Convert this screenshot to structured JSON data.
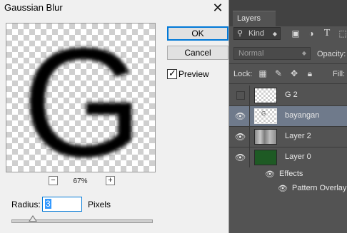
{
  "dialog": {
    "title": "Gaussian Blur",
    "close_glyph": "✕",
    "preview_letter": "G",
    "zoom_minus": "−",
    "zoom_plus": "+",
    "zoom_level": "67%",
    "ok_label": "OK",
    "cancel_label": "Cancel",
    "preview_check_glyph": "✓",
    "preview_label": "Preview",
    "preview_checked": true,
    "radius_label": "Radius:",
    "radius_value": "3",
    "pixels_label": "Pixels"
  },
  "layers_panel": {
    "tab_label": "Layers",
    "kind_label": "Kind",
    "blend_mode": "Normal",
    "opacity_label": "Opacity:",
    "lock_label": "Lock:",
    "fill_label": "Fill:",
    "filter_icons": [
      "image-filter-icon",
      "adjustment-filter-icon",
      "type-filter-icon",
      "shape-filter-icon"
    ],
    "layers": [
      {
        "name": "G 2",
        "visible": false,
        "selected": false,
        "thumb": "transparent"
      },
      {
        "name": "bayangan",
        "visible": true,
        "selected": true,
        "thumb": "transparent"
      },
      {
        "name": "Layer 2",
        "visible": true,
        "selected": false,
        "thumb": "stone"
      },
      {
        "name": "Layer 0",
        "visible": true,
        "selected": false,
        "thumb": "green"
      }
    ],
    "effects_label": "Effects",
    "effect_items": [
      "Pattern Overlay"
    ]
  },
  "colors": {
    "panel_bg": "#535353",
    "selected_row": "#6f7a8b",
    "accent": "#0078d7"
  }
}
